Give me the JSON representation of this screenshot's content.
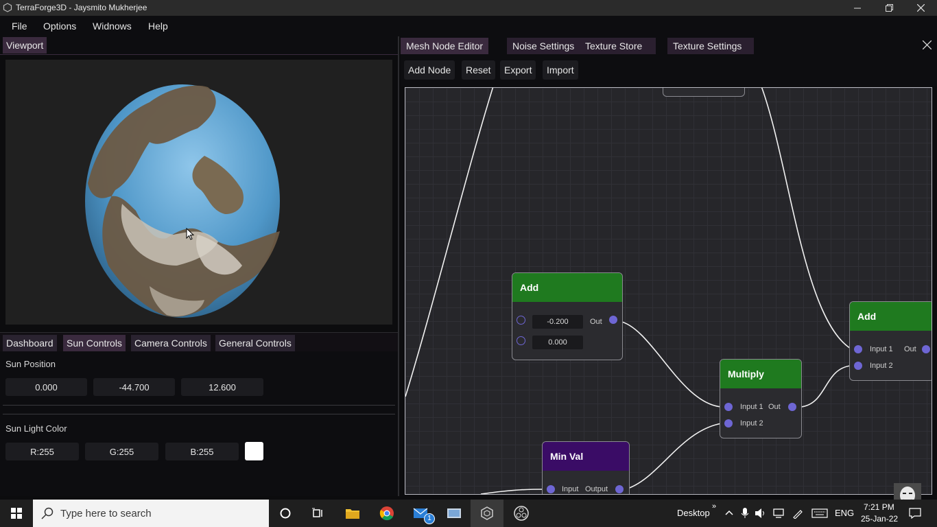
{
  "window": {
    "title": "TerraForge3D - Jaysmito Mukherjee"
  },
  "menu": [
    "File",
    "Options",
    "Widnows",
    "Help"
  ],
  "viewport": {
    "tab": "Viewport"
  },
  "controls": {
    "tabs": [
      "Dashboard",
      "Sun Controls",
      "Camera Controls",
      "General Controls"
    ],
    "sun_position_label": "Sun Position",
    "sun_position": [
      "0.000",
      "-44.700",
      "12.600"
    ],
    "sun_light_color_label": "Sun Light Color",
    "sun_color": [
      "R:255",
      "G:255",
      "B:255"
    ],
    "sun_swatch": "#ffffff"
  },
  "editor": {
    "tabs": [
      "Mesh Node Editor",
      "Noise Settings",
      "Texture Store",
      "Texture Settings"
    ],
    "toolbar": [
      "Add Node",
      "Reset",
      "Export",
      "Import"
    ],
    "nodes": {
      "add1": {
        "title": "Add",
        "value1": "-0.200",
        "value2": "0.000",
        "out": "Out"
      },
      "multiply": {
        "title": "Multiply",
        "in1": "Input 1",
        "in2": "Input 2",
        "out": "Out"
      },
      "add2": {
        "title": "Add",
        "in1": "Input 1",
        "in2": "Input 2",
        "out": "Out"
      },
      "minval": {
        "title": "Min Val",
        "in": "Input",
        "out": "Output"
      }
    },
    "colors": {
      "add_header": "#1f7a1f",
      "minval_header": "#3a0c66",
      "pin": "#6e66d4"
    }
  },
  "taskbar": {
    "search_placeholder": "Type here to search",
    "desktop_label": "Desktop",
    "language": "ENG",
    "time": "7:21 PM",
    "date": "25-Jan-22",
    "mail_badge": "1"
  }
}
